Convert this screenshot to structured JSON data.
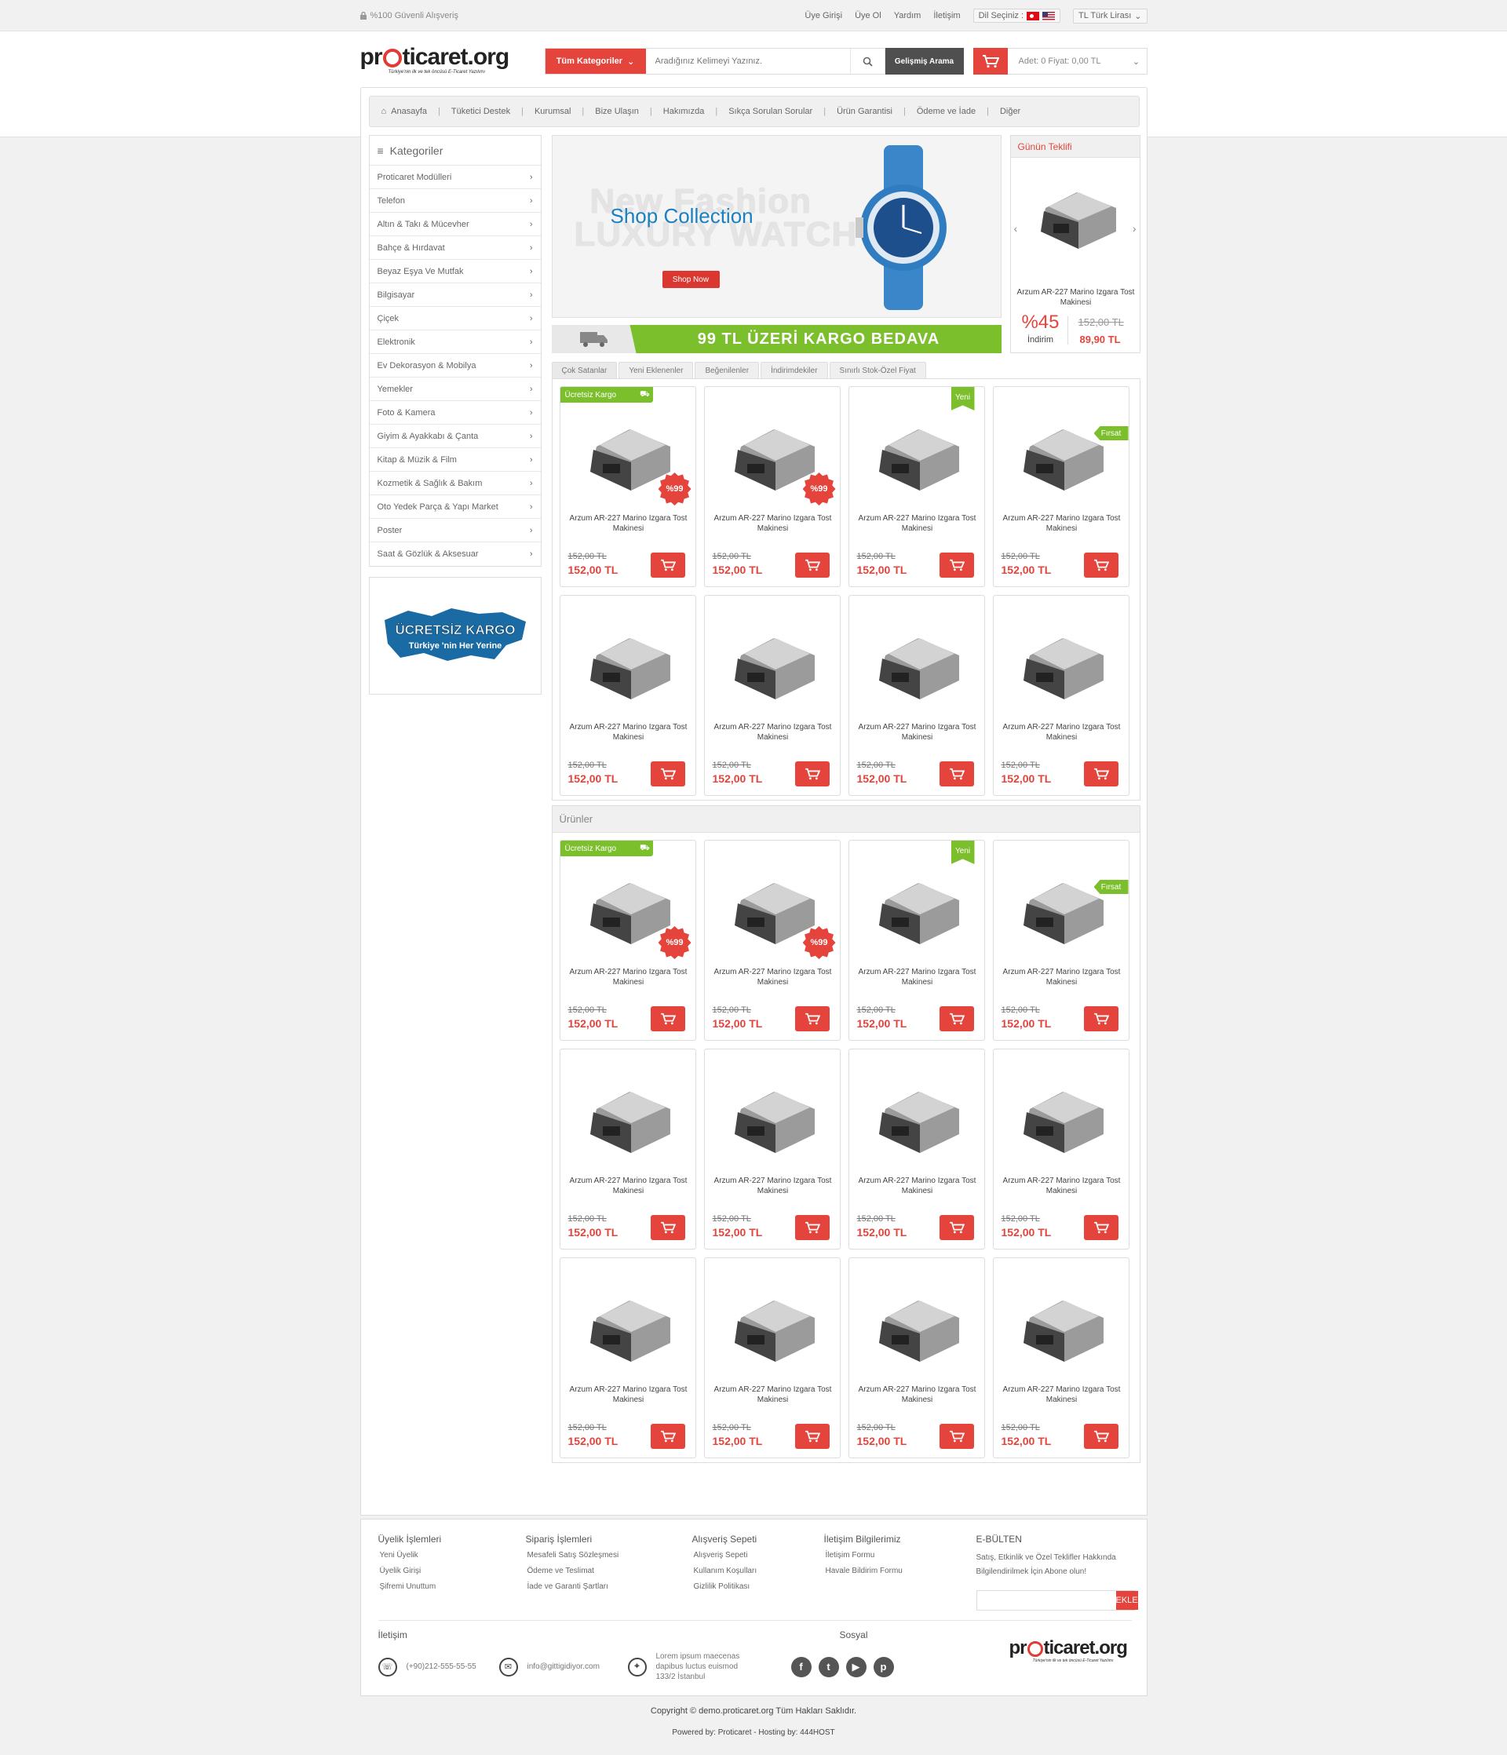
{
  "topbar": {
    "secure_text": "%100 Güvenli Alışveriş",
    "links": [
      "Üye Girişi",
      "Üye Ol",
      "Yardım",
      "İletişim"
    ],
    "language_label": "Dil Seçiniz :",
    "currency": "TL Türk Lirası"
  },
  "header": {
    "logo_text": "proticaret.org",
    "logo_tagline": "Türkiye'nin ilk ve tek öncüsü E-Ticaret Yazılımı",
    "category_button": "Tüm Kategoriler",
    "search_placeholder": "Aradığınız Kelimeyi Yazınız.",
    "advanced_search": "Gelişmiş Arama",
    "cart_summary": "Adet: 0   Fiyat: 0,00 TL"
  },
  "nav": [
    "Anasayfa",
    "Tüketici Destek",
    "Kurumsal",
    "Bize Ulaşın",
    "Hakımızda",
    "Sıkça Sorulan Sorular",
    "Ürün Garantisi",
    "Ödeme ve İade",
    "Diğer"
  ],
  "sidebar": {
    "title": "Kategoriler",
    "items": [
      "Proticaret Modülleri",
      "Telefon",
      "Altın & Takı & Mücevher",
      "Bahçe & Hırdavat",
      "Beyaz Eşya Ve Mutfak",
      "Bilgisayar",
      "Çiçek",
      "Elektronik",
      "Ev Dekorasyon & Mobilya",
      "Yemekler",
      "Foto & Kamera",
      "Giyim & Ayakkabı & Çanta",
      "Kitap & Müzik & Film",
      "Kozmetik & Sağlık & Bakım",
      "Oto Yedek Parça & Yapı Market",
      "Poster",
      "Saat & Gözlük & Aksesuar"
    ],
    "ad_line1": "ÜCRETSİZ KARGO",
    "ad_line2": "Türkiye 'nin Her Yerine"
  },
  "slider": {
    "line1": "New Fashion",
    "line2": "Shop Collection",
    "line3": "LUXURY WATCH",
    "button": "Shop Now"
  },
  "daily": {
    "title": "Günün Teklifi",
    "product": "Arzum AR-227 Marino Izgara Tost Makinesi",
    "discount": "%45",
    "discount_label": "İndirim",
    "old_price": "152,00 TL",
    "new_price": "89,90 TL"
  },
  "shipping_banner": "99 TL ÜZERİ KARGO BEDAVA",
  "tabs": [
    "Çok Satanlar",
    "Yeni Eklenenler",
    "Beğenilenler",
    "İndirimdekiler",
    "Sınırlı Stok-Özel Fiyat"
  ],
  "product": {
    "name": "Arzum AR-227 Marino Izgara Tost Makinesi",
    "old_price": "152,00 TL",
    "price": "152,00 TL"
  },
  "badges": {
    "kargo": "Ücretsiz Kargo",
    "pct": "%99",
    "yeni": "Yeni",
    "firsat": "Fırsat"
  },
  "urunler_title": "Ürünler",
  "footer": {
    "col1": {
      "title": "Üyelik İşlemleri",
      "links": [
        "Yeni Üyelik",
        "Üyelik Girişi",
        "Şifremi Unuttum"
      ]
    },
    "col2": {
      "title": "Sipariş İşlemleri",
      "links": [
        "Mesafeli Satış Sözleşmesi",
        "Ödeme ve Teslimat",
        "İade ve Garanti Şartları"
      ]
    },
    "col3": {
      "title": "Alışveriş Sepeti",
      "links": [
        "Alışveriş Sepeti",
        "Kullanım Koşulları",
        "Gizlilik Politikası"
      ]
    },
    "col4": {
      "title": "İletişim Bilgilerimiz",
      "links": [
        "İletişim Formu",
        "Havale Bildirim Formu"
      ]
    },
    "ebulten_title": "E-BÜLTEN",
    "ebulten_text": "Satış, Etkinlik ve Özel Teklifler Hakkında Bilgilendirilmek İçin Abone olun!",
    "ebulten_button": "EKLE",
    "contact_title": "İletişim",
    "phone": "(+90)212-555-55-55",
    "email": "info@gittigidiyor.com",
    "address": "Lorem ipsum maecenas dapibus luctus euismod 133/2 İstanbul",
    "social_title": "Sosyal",
    "copyright": "Copyright © demo.proticaret.org Tüm Hakları Saklıdır.",
    "powered": "Powered by: Proticaret - Hosting by: 444HOST"
  }
}
